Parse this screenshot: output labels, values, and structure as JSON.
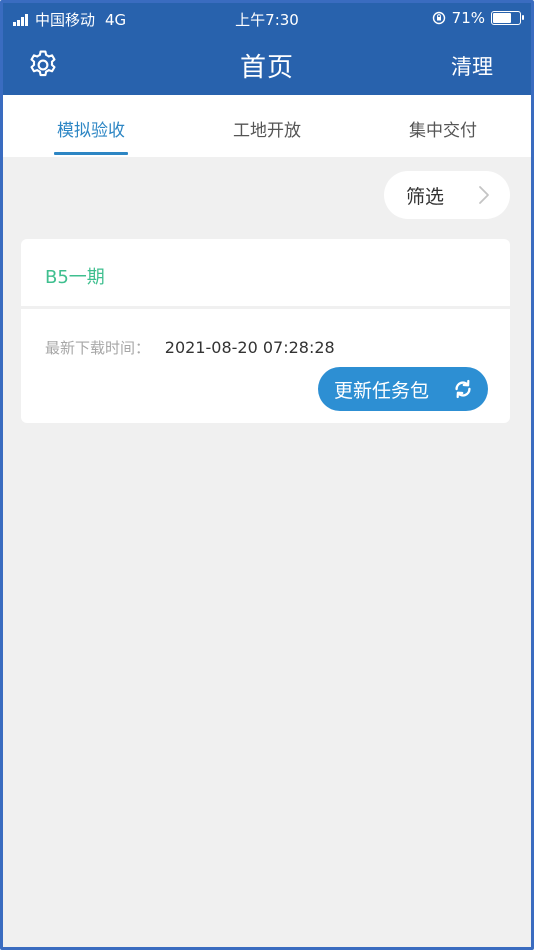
{
  "status_bar": {
    "carrier": "中国移动",
    "network": "4G",
    "time": "上午7:30",
    "battery": "71%",
    "battery_level": 0.71
  },
  "nav": {
    "title": "首页",
    "right_action": "清理",
    "left_icon": "gear-icon"
  },
  "tabs": [
    {
      "label": "模拟验收",
      "active": true
    },
    {
      "label": "工地开放",
      "active": false
    },
    {
      "label": "集中交付",
      "active": false
    }
  ],
  "filter": {
    "label": "筛选",
    "icon": "chevron-right-icon"
  },
  "project_card": {
    "name": "B5一期",
    "download_label": "最新下载时间：",
    "download_time": "2021-08-20 07:28:28",
    "update_button": "更新任务包",
    "update_icon": "refresh-icon"
  },
  "colors": {
    "primary": "#2862ad",
    "accent": "#2d86c4",
    "project_name": "#3fbf8f",
    "background": "#f0f0f0"
  }
}
